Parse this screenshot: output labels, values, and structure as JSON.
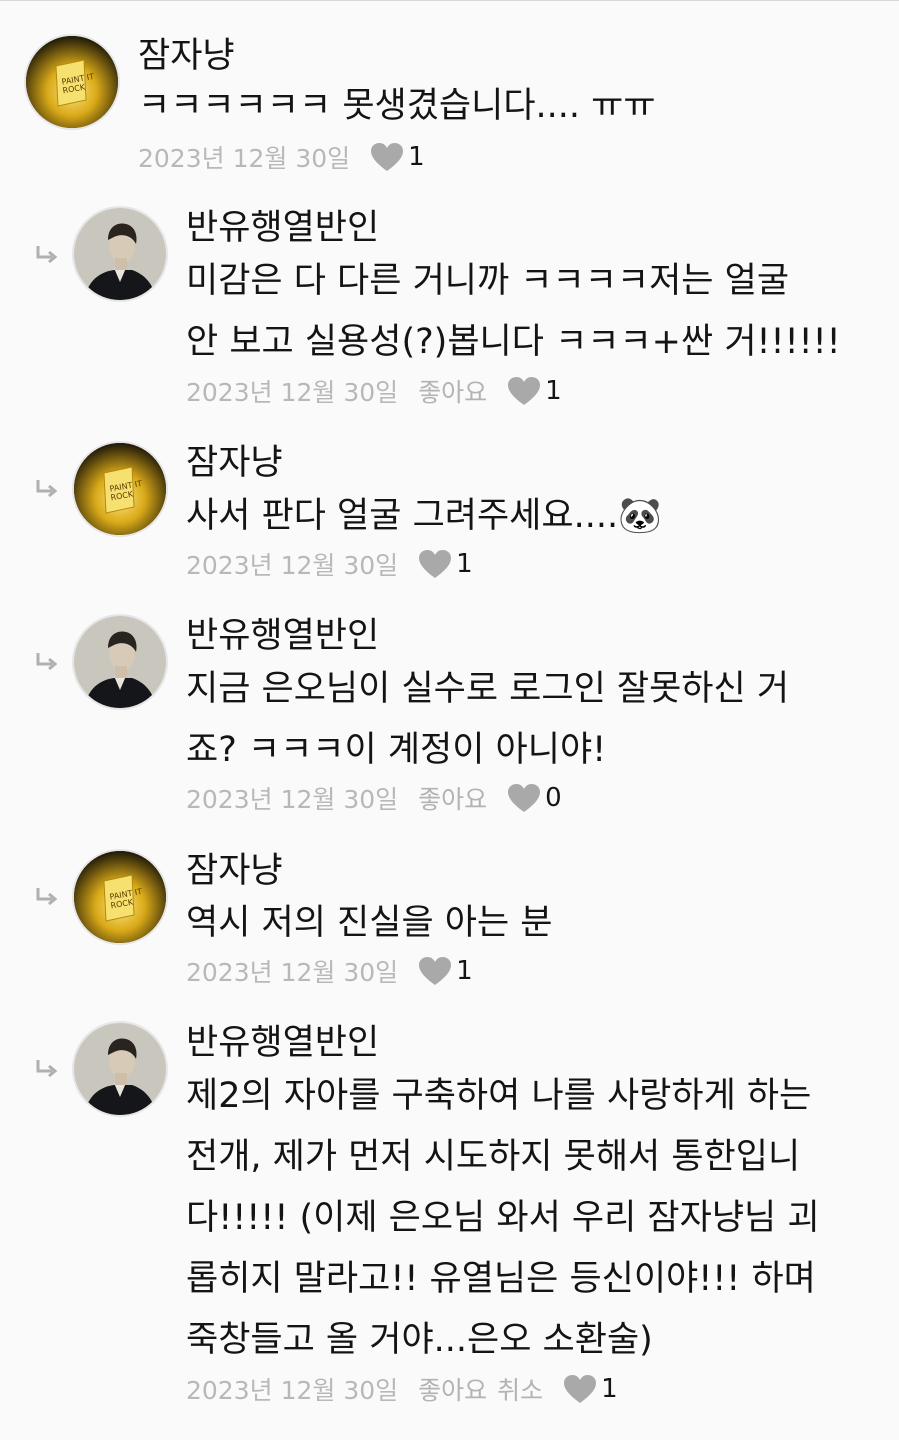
{
  "labels": {
    "like": "좋아요",
    "cancel": "취소"
  },
  "colors": {
    "background": "#fafafa",
    "text": "#141414",
    "meta": "#b8b8b8",
    "heart": "#a9a9a9"
  },
  "comments": [
    {
      "author": "잠자냥",
      "avatar": "lamp-avatar",
      "avatar_text": [
        "PAINT IT",
        "ROCK"
      ],
      "lines": [
        "ㅋㅋㅋㅋㅋㅋ 못생겼습니다.... ㅠㅠ"
      ],
      "date": "2023년 12월 30일",
      "likes": "1",
      "show_like_label": false,
      "show_cancel": false
    },
    {
      "author": "반유행열반인",
      "avatar": "portrait-avatar",
      "lines": [
        "미감은 다 다른 거니까 ㅋㅋㅋㅋ저는 얼굴",
        "안 보고 실용성(?)봅니다 ㅋㅋㅋ+싼 거!!!!!!"
      ],
      "date": "2023년 12월 30일",
      "likes": "1",
      "show_like_label": true,
      "show_cancel": false
    },
    {
      "author": "잠자냥",
      "avatar": "lamp-avatar",
      "avatar_text": [
        "PAINT IT",
        "ROCK"
      ],
      "lines": [
        "사서 판다 얼굴 그려주세요....🐼"
      ],
      "date": "2023년 12월 30일",
      "likes": "1",
      "show_like_label": false,
      "show_cancel": false
    },
    {
      "author": "반유행열반인",
      "avatar": "portrait-avatar",
      "lines": [
        "지금 은오님이 실수로 로그인 잘못하신 거",
        "죠? ㅋㅋㅋ이 계정이 아니야!"
      ],
      "date": "2023년 12월 30일",
      "likes": "0",
      "show_like_label": true,
      "show_cancel": false
    },
    {
      "author": "잠자냥",
      "avatar": "lamp-avatar",
      "avatar_text": [
        "PAINT IT",
        "ROCK"
      ],
      "lines": [
        "역시 저의 진실을 아는 분"
      ],
      "date": "2023년 12월 30일",
      "likes": "1",
      "show_like_label": false,
      "show_cancel": false
    },
    {
      "author": "반유행열반인",
      "avatar": "portrait-avatar",
      "lines": [
        "제2의 자아를 구축하여 나를 사랑하게 하는",
        "전개, 제가 먼저 시도하지 못해서 통한입니",
        "다!!!!! (이제 은오님 와서 우리 잠자냥님 괴",
        "롭히지 말라고!! 유열님은 등신이야!!! 하며",
        "죽창들고 올 거야...은오 소환술)"
      ],
      "date": "2023년 12월 30일",
      "likes": "1",
      "show_like_label": true,
      "show_cancel": true
    }
  ]
}
